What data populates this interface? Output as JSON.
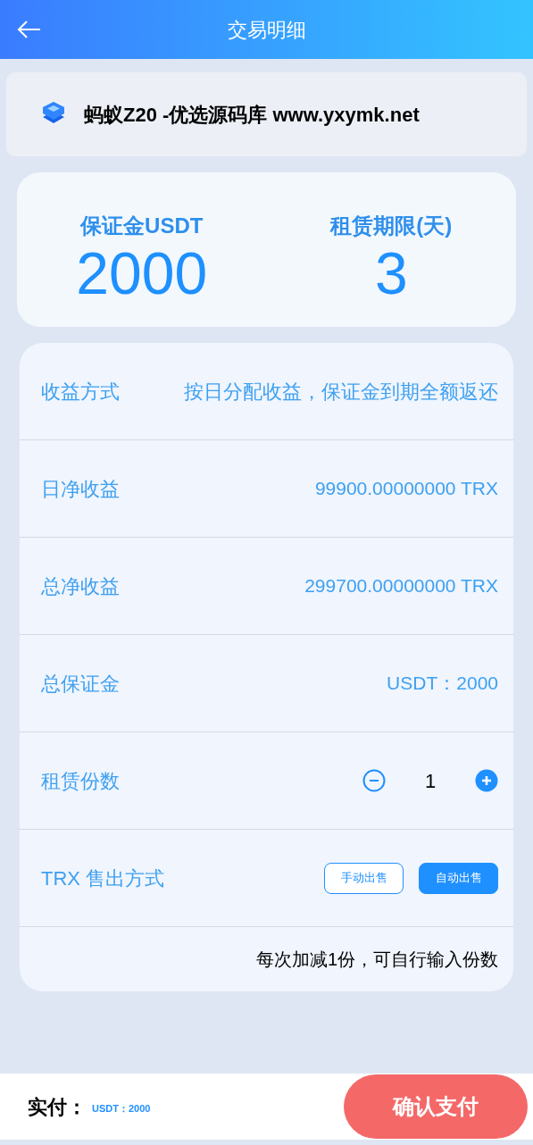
{
  "header": {
    "title": "交易明细"
  },
  "banner": {
    "text": "蚂蚁Z20 -优选源码库 www.yxymk.net"
  },
  "stats": [
    {
      "label": "保证金USDT",
      "value": "2000"
    },
    {
      "label": "租赁期限(天)",
      "value": "3"
    }
  ],
  "rows": [
    {
      "kind": "text",
      "label": "收益方式",
      "value": "按日分配收益，保证金到期全额返还"
    },
    {
      "kind": "text",
      "label": "日净收益",
      "value": "99900.00000000 TRX"
    },
    {
      "kind": "text",
      "label": "总净收益",
      "value": "299700.00000000 TRX"
    },
    {
      "kind": "text",
      "label": "总保证金",
      "value": "USDT：2000"
    },
    {
      "kind": "stepper",
      "label": "租赁份数",
      "value": "1"
    },
    {
      "kind": "choice",
      "label": "TRX 售出方式",
      "options": [
        {
          "label": "手动出售",
          "selected": false
        },
        {
          "label": "自动出售",
          "selected": true
        }
      ]
    }
  ],
  "note": "每次加减1份，可自行输入份数",
  "footer": {
    "label": "实付：",
    "amount": "USDT：2000",
    "button": "确认支付"
  }
}
